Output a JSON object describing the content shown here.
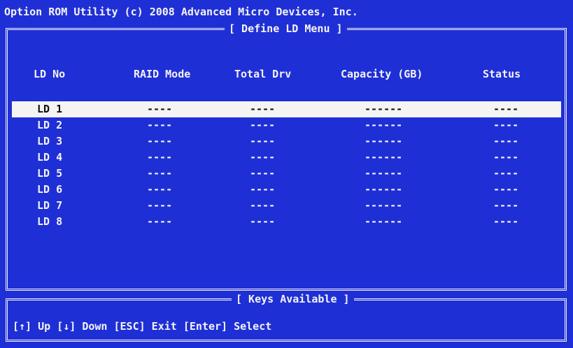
{
  "app_title": "Option ROM Utility (c) 2008 Advanced Micro Devices, Inc.",
  "menu_caption": "[ Define LD Menu ]",
  "columns": {
    "ld_no": "LD No",
    "raid_mode": "RAID Mode",
    "total_drv": "Total Drv",
    "capacity": "Capacity (GB)",
    "status": "Status"
  },
  "rows": [
    {
      "ld": "LD 1",
      "raid": "----",
      "drv": "----",
      "cap": "------",
      "status": "----",
      "selected": true
    },
    {
      "ld": "LD 2",
      "raid": "----",
      "drv": "----",
      "cap": "------",
      "status": "----"
    },
    {
      "ld": "LD 3",
      "raid": "----",
      "drv": "----",
      "cap": "------",
      "status": "----"
    },
    {
      "ld": "LD 4",
      "raid": "----",
      "drv": "----",
      "cap": "------",
      "status": "----"
    },
    {
      "ld": "LD 5",
      "raid": "----",
      "drv": "----",
      "cap": "------",
      "status": "----"
    },
    {
      "ld": "LD 6",
      "raid": "----",
      "drv": "----",
      "cap": "------",
      "status": "----"
    },
    {
      "ld": "LD 7",
      "raid": "----",
      "drv": "----",
      "cap": "------",
      "status": "----"
    },
    {
      "ld": "LD 8",
      "raid": "----",
      "drv": "----",
      "cap": "------",
      "status": "----"
    }
  ],
  "keys_caption": "[ Keys Available ]",
  "keys_help": "[↑] Up  [↓] Down  [ESC] Exit  [Enter] Select",
  "colors": {
    "background": "#1f2fd6",
    "foreground": "#f4f4f4",
    "highlight_bg": "#f4f4f4",
    "highlight_fg": "#111111"
  }
}
